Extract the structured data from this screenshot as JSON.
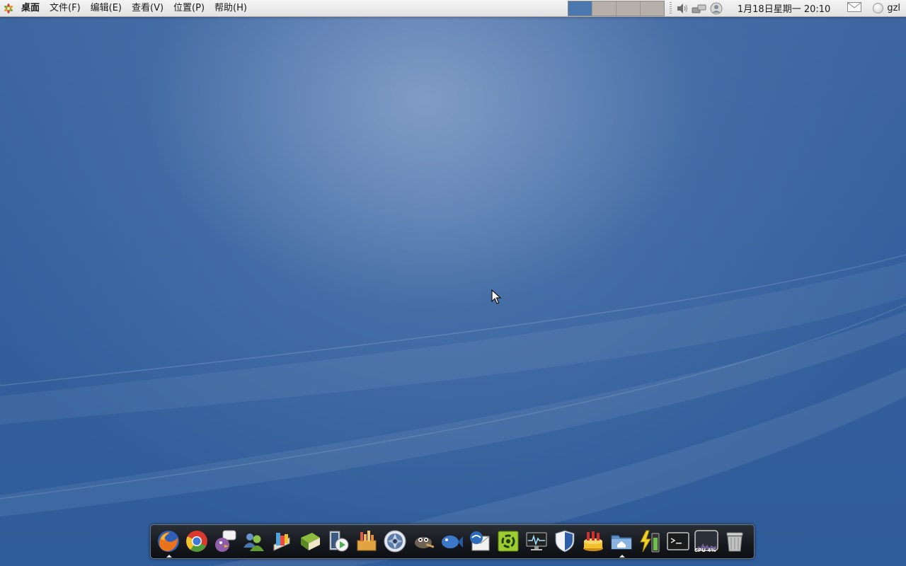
{
  "top_panel": {
    "menu": {
      "desktop": "桌面",
      "file": "文件(F)",
      "edit": "编辑(E)",
      "view": "查看(V)",
      "places": "位置(P)",
      "help": "帮助(H)"
    },
    "workspaces": {
      "count": 4,
      "active_index": 0,
      "active_color": "#4c78b0",
      "inactive_color": "#b7b0aa"
    },
    "tray_icons": [
      "volume-icon",
      "network-icon",
      "user-presence-icon"
    ],
    "clock": "1月18日星期一 20:10",
    "mail_icon": "mail-icon",
    "username": "gzl"
  },
  "dock": {
    "items": [
      {
        "name": "firefox-icon",
        "running": true
      },
      {
        "name": "chrome-icon",
        "running": false
      },
      {
        "name": "pidgin-icon",
        "running": false
      },
      {
        "name": "contacts-icon",
        "running": false
      },
      {
        "name": "stardict-icon",
        "running": false
      },
      {
        "name": "book-icon",
        "running": false
      },
      {
        "name": "media-player-icon",
        "running": false
      },
      {
        "name": "package-manager-icon",
        "running": false
      },
      {
        "name": "camera-aperture-icon",
        "running": false
      },
      {
        "name": "gimp-icon",
        "running": false
      },
      {
        "name": "fish-icon",
        "running": false
      },
      {
        "name": "thunderbird-icon",
        "running": false
      },
      {
        "name": "recycle-settings-icon",
        "running": false
      },
      {
        "name": "system-monitor-icon",
        "running": false
      },
      {
        "name": "shield-icon",
        "running": false
      },
      {
        "name": "cake-icon",
        "running": false
      },
      {
        "name": "home-folder-icon",
        "running": true
      },
      {
        "name": "battery-icon",
        "running": false
      },
      {
        "name": "terminal-icon",
        "running": false
      },
      {
        "name": "cpu-monitor-icon",
        "running": false,
        "label": "CPU 4%"
      },
      {
        "name": "trash-icon",
        "running": false
      }
    ]
  },
  "colors": {
    "desktop_blue": "#34609d",
    "panel_bg": "#e6e6e6",
    "dock_bg": "#15181d"
  }
}
